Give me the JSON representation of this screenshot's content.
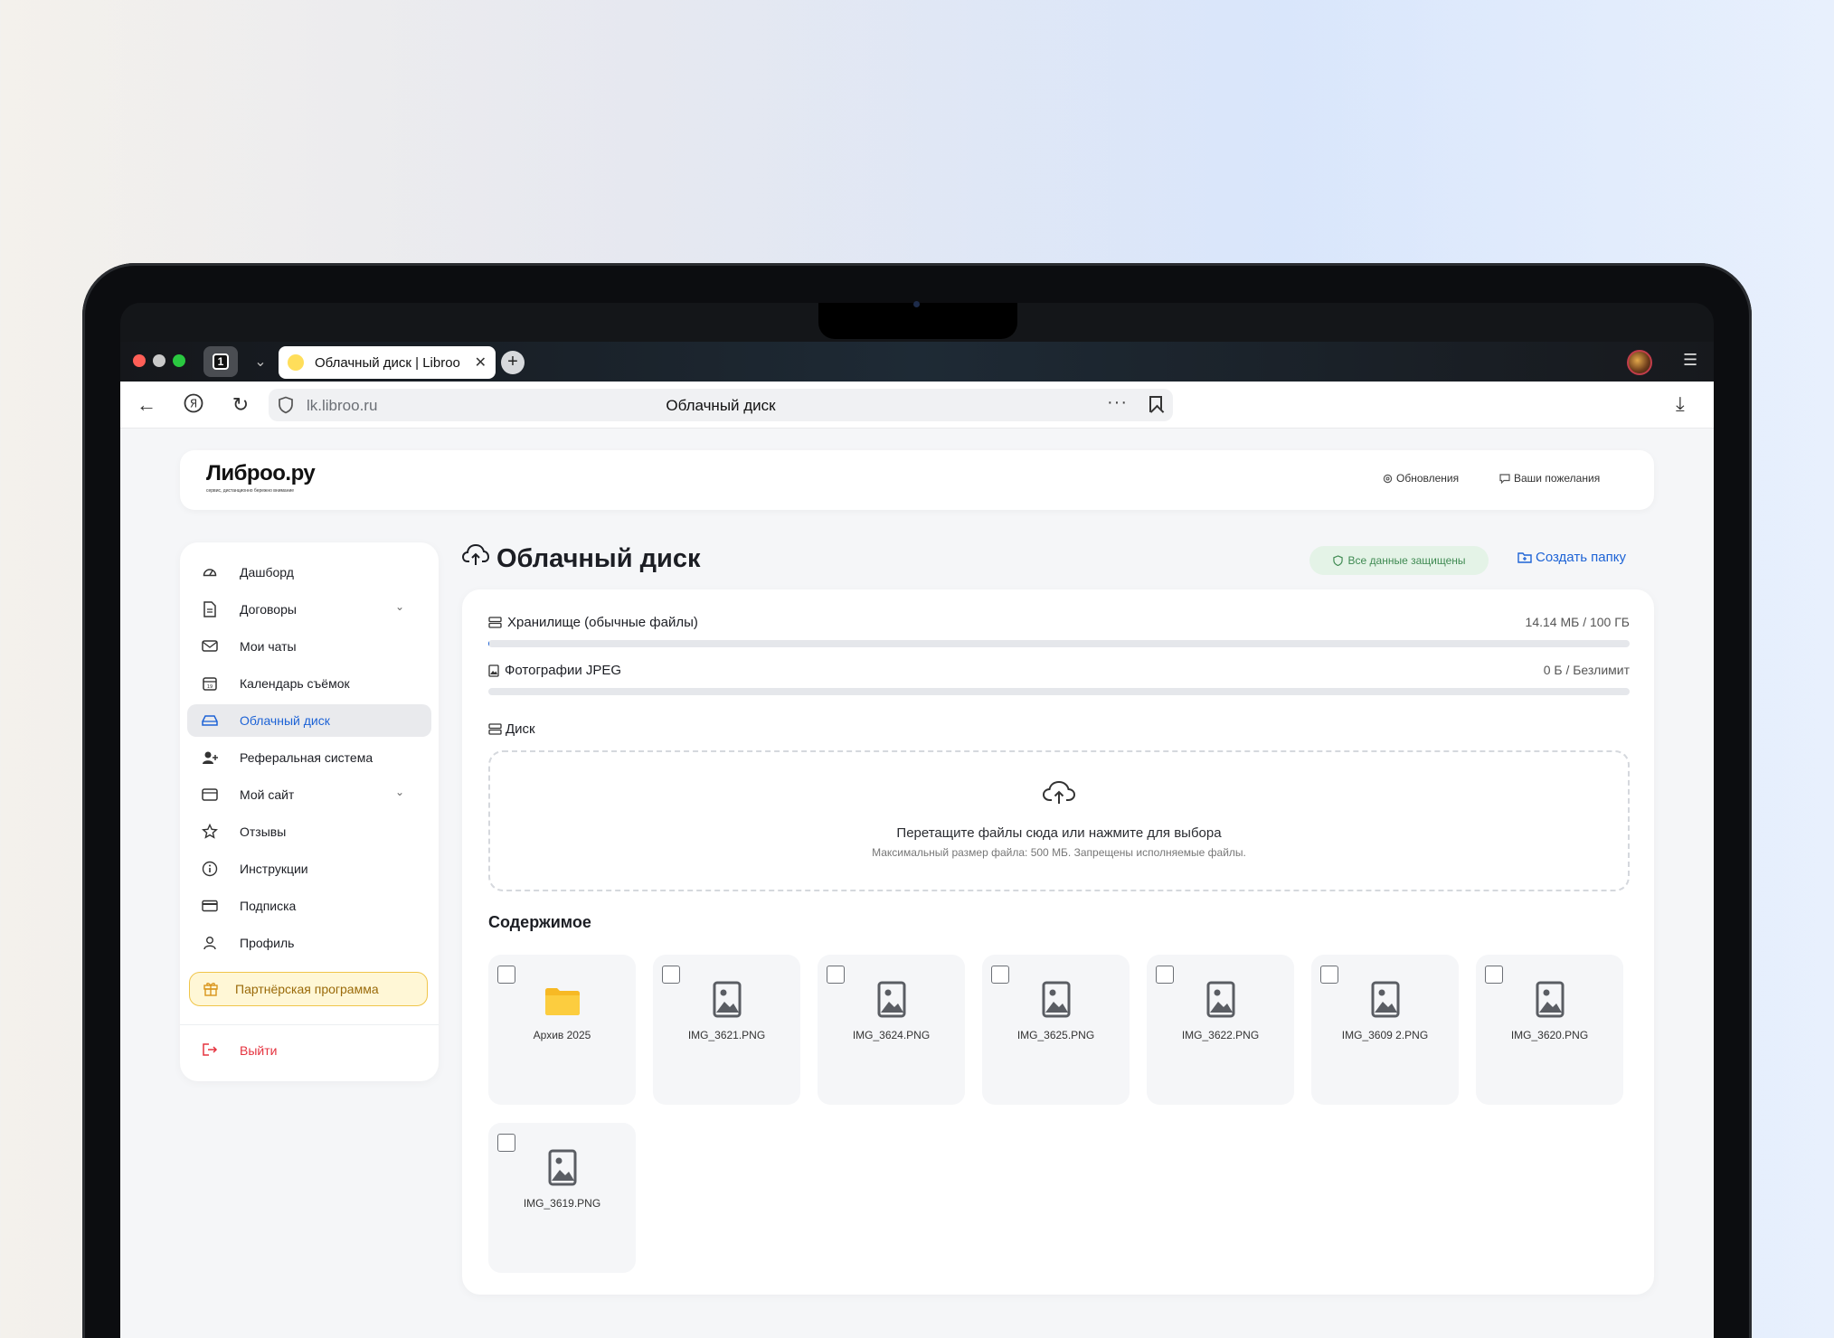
{
  "browser": {
    "tab_count": "1",
    "active_tab_title": "Облачный диск | Libroo",
    "url_host": "lk.libroo.ru",
    "page_title": "Облачный диск"
  },
  "header": {
    "logo_text": "Либроо.ру",
    "logo_tagline": "сервис, дистанционно бережно внимание",
    "updates_label": "Обновления",
    "wishes_label": "Ваши пожелания"
  },
  "sidebar": {
    "items": [
      {
        "label": "Дашборд",
        "icon": "gauge-icon"
      },
      {
        "label": "Договоры",
        "icon": "document-icon",
        "expandable": true
      },
      {
        "label": "Мои чаты",
        "icon": "chat-icon"
      },
      {
        "label": "Календарь съёмок",
        "icon": "calendar-icon"
      },
      {
        "label": "Облачный диск",
        "icon": "drive-icon",
        "active": true
      },
      {
        "label": "Реферальная система",
        "icon": "user-plus-icon"
      },
      {
        "label": "Мой сайт",
        "icon": "window-icon",
        "expandable": true
      },
      {
        "label": "Отзывы",
        "icon": "star-icon"
      },
      {
        "label": "Инструкции",
        "icon": "info-icon"
      },
      {
        "label": "Подписка",
        "icon": "card-icon"
      },
      {
        "label": "Профиль",
        "icon": "user-icon"
      }
    ],
    "partner_label": "Партнёрская программа",
    "logout_label": "Выйти"
  },
  "main": {
    "title": "Облачный диск",
    "secure_badge": "Все данные защищены",
    "create_folder": "Создать папку",
    "storage": [
      {
        "label": "Хранилище (обычные файлы)",
        "value": "14.14 МБ / 100 ГБ",
        "fill": 0.0001
      },
      {
        "label": "Фотографии JPEG",
        "value": "0 Б / Безлимит",
        "fill": 0
      }
    ],
    "disk_label": "Диск",
    "dropzone_main": "Перетащите файлы сюда или нажмите для выбора",
    "dropzone_sub": "Максимальный размер файла: 500 МБ. Запрещены исполняемые файлы.",
    "content_title": "Содержимое",
    "files": [
      {
        "name": "Архив 2025",
        "type": "folder"
      },
      {
        "name": "IMG_3621.PNG",
        "type": "image"
      },
      {
        "name": "IMG_3624.PNG",
        "type": "image"
      },
      {
        "name": "IMG_3625.PNG",
        "type": "image"
      },
      {
        "name": "IMG_3622.PNG",
        "type": "image"
      },
      {
        "name": "IMG_3609 2.PNG",
        "type": "image"
      },
      {
        "name": "IMG_3620.PNG",
        "type": "image"
      },
      {
        "name": "IMG_3619.PNG",
        "type": "image"
      }
    ]
  },
  "colors": {
    "accent": "#1d63d6",
    "danger": "#e5333f",
    "success_bg": "#e4f3e7",
    "folder": "#f7b924"
  }
}
